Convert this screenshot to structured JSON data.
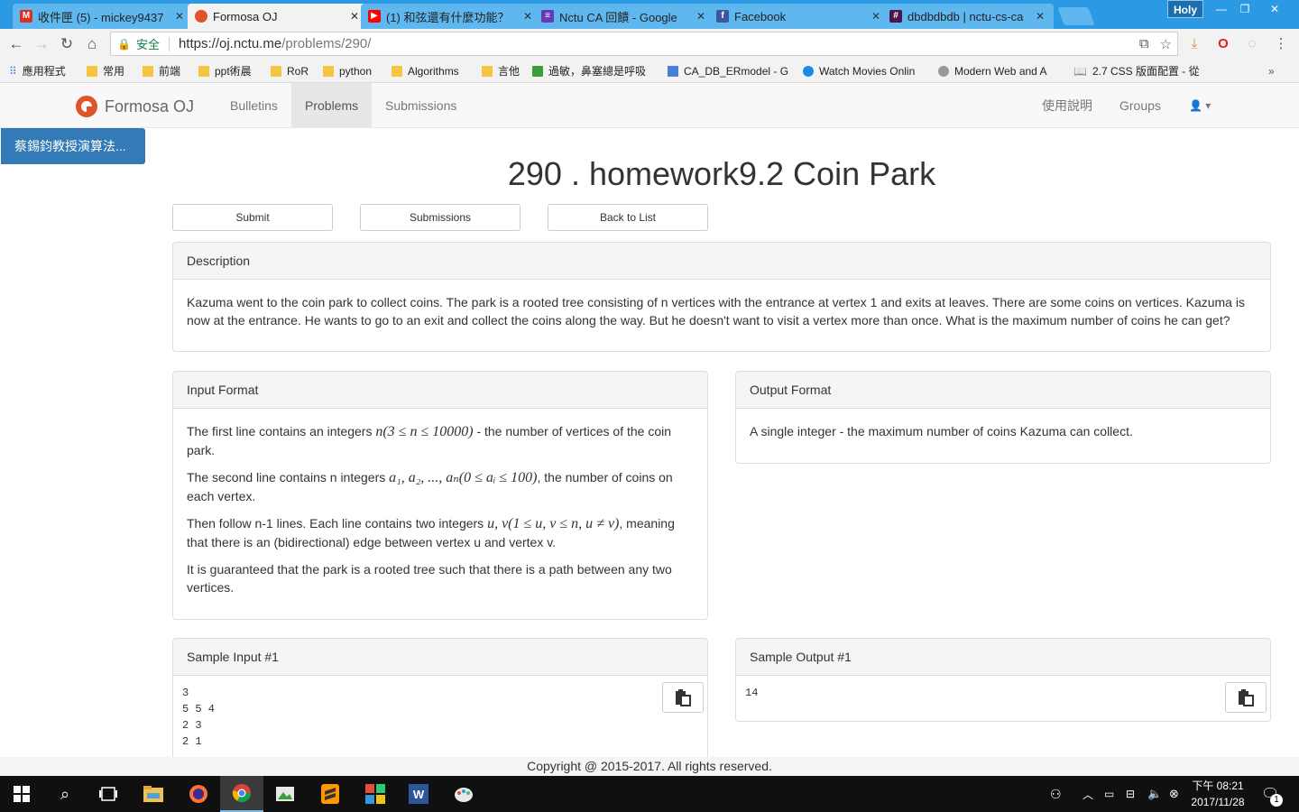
{
  "browser": {
    "tabs": [
      {
        "title": "收件匣 (5) - mickey9437",
        "icon": "gmail-icon",
        "color": "#d93025"
      },
      {
        "title": "Formosa OJ",
        "icon": "formosa-icon",
        "color": "#e0542b"
      },
      {
        "title": "(1) 和弦還有什麼功能？",
        "icon": "youtube-icon",
        "color": "#ff0000"
      },
      {
        "title": "Nctu CA 回饋 - Google",
        "icon": "forms-icon",
        "color": "#673ab7"
      },
      {
        "title": "Facebook",
        "icon": "facebook-icon",
        "color": "#3b5998"
      },
      {
        "title": "dbdbdbdb | nctu-cs-ca",
        "icon": "slack-icon",
        "color": "#4a154b"
      }
    ],
    "profile_name": "Holy",
    "secure_label": "安全",
    "url_host": "https://oj.nctu.me",
    "url_path": "/problems/290/",
    "bookmarks": [
      {
        "label": "應用程式",
        "type": "apps"
      },
      {
        "label": "常用",
        "type": "folder"
      },
      {
        "label": "前端",
        "type": "folder"
      },
      {
        "label": "ppt術晨",
        "type": "folder"
      },
      {
        "label": "RoR",
        "type": "folder"
      },
      {
        "label": "python",
        "type": "folder"
      },
      {
        "label": "Algorithms",
        "type": "folder"
      },
      {
        "label": "言他",
        "type": "folder"
      },
      {
        "label": "過敏，鼻塞總是呼吸",
        "type": "site"
      },
      {
        "label": "CA_DB_ERmodel - G",
        "type": "site"
      },
      {
        "label": "Watch Movies Onlin",
        "type": "site"
      },
      {
        "label": "Modern Web and A",
        "type": "site"
      },
      {
        "label": "2.7 CSS 版面配置 - 從",
        "type": "site"
      }
    ]
  },
  "site": {
    "brand": "Formosa OJ",
    "nav": [
      "Bulletins",
      "Problems",
      "Submissions"
    ],
    "nav_right": [
      "使用說明",
      "Groups"
    ],
    "sidebar_button": "蔡錫鈞教授演算法..."
  },
  "problem": {
    "title": "290 . homework9.2 Coin Park",
    "actions": [
      "Submit",
      "Submissions",
      "Back to List"
    ],
    "description_heading": "Description",
    "description": "Kazuma went to the coin park to collect coins. The park is a rooted tree consisting of n vertices with the entrance at vertex 1 and exits at leaves. There are some coins on vertices. Kazuma is now at the entrance. He wants to go to an exit and collect the coins along the way. But he doesn't want to visit a vertex more than once. What is the maximum number of coins he can get?",
    "input_heading": "Input Format",
    "input_p1_a": "The first line contains an integers ",
    "input_p1_math": "n(3 ≤ n ≤ 10000)",
    "input_p1_b": " - the number of vertices of the coin park.",
    "input_p2_a": "The second line contains n integers ",
    "input_p2_math": "a₁, a₂, ..., aₙ(0 ≤ aᵢ ≤ 100)",
    "input_p2_b": ", the number of coins on each vertex.",
    "input_p3_a": "Then follow n-1 lines. Each line contains two integers ",
    "input_p3_math": "u, v(1 ≤ u, v ≤ n, u ≠ v)",
    "input_p3_b": ", meaning that there is an (bidirectional) edge between vertex u and vertex v.",
    "input_p4": "It is guaranteed that the park is a rooted tree such that there is a path between any two vertices.",
    "output_heading": "Output Format",
    "output": "A single integer - the maximum number of coins Kazuma can collect.",
    "sample_input_heading": "Sample Input #1",
    "sample_input": "3\n5 5 4\n2 3\n2 1",
    "sample_output_heading": "Sample Output #1",
    "sample_output": "14"
  },
  "footer": "Copyright @ 2015-2017. All rights reserved.",
  "taskbar": {
    "time": "下午 08:21",
    "date": "2017/11/28",
    "notification_count": "1"
  }
}
